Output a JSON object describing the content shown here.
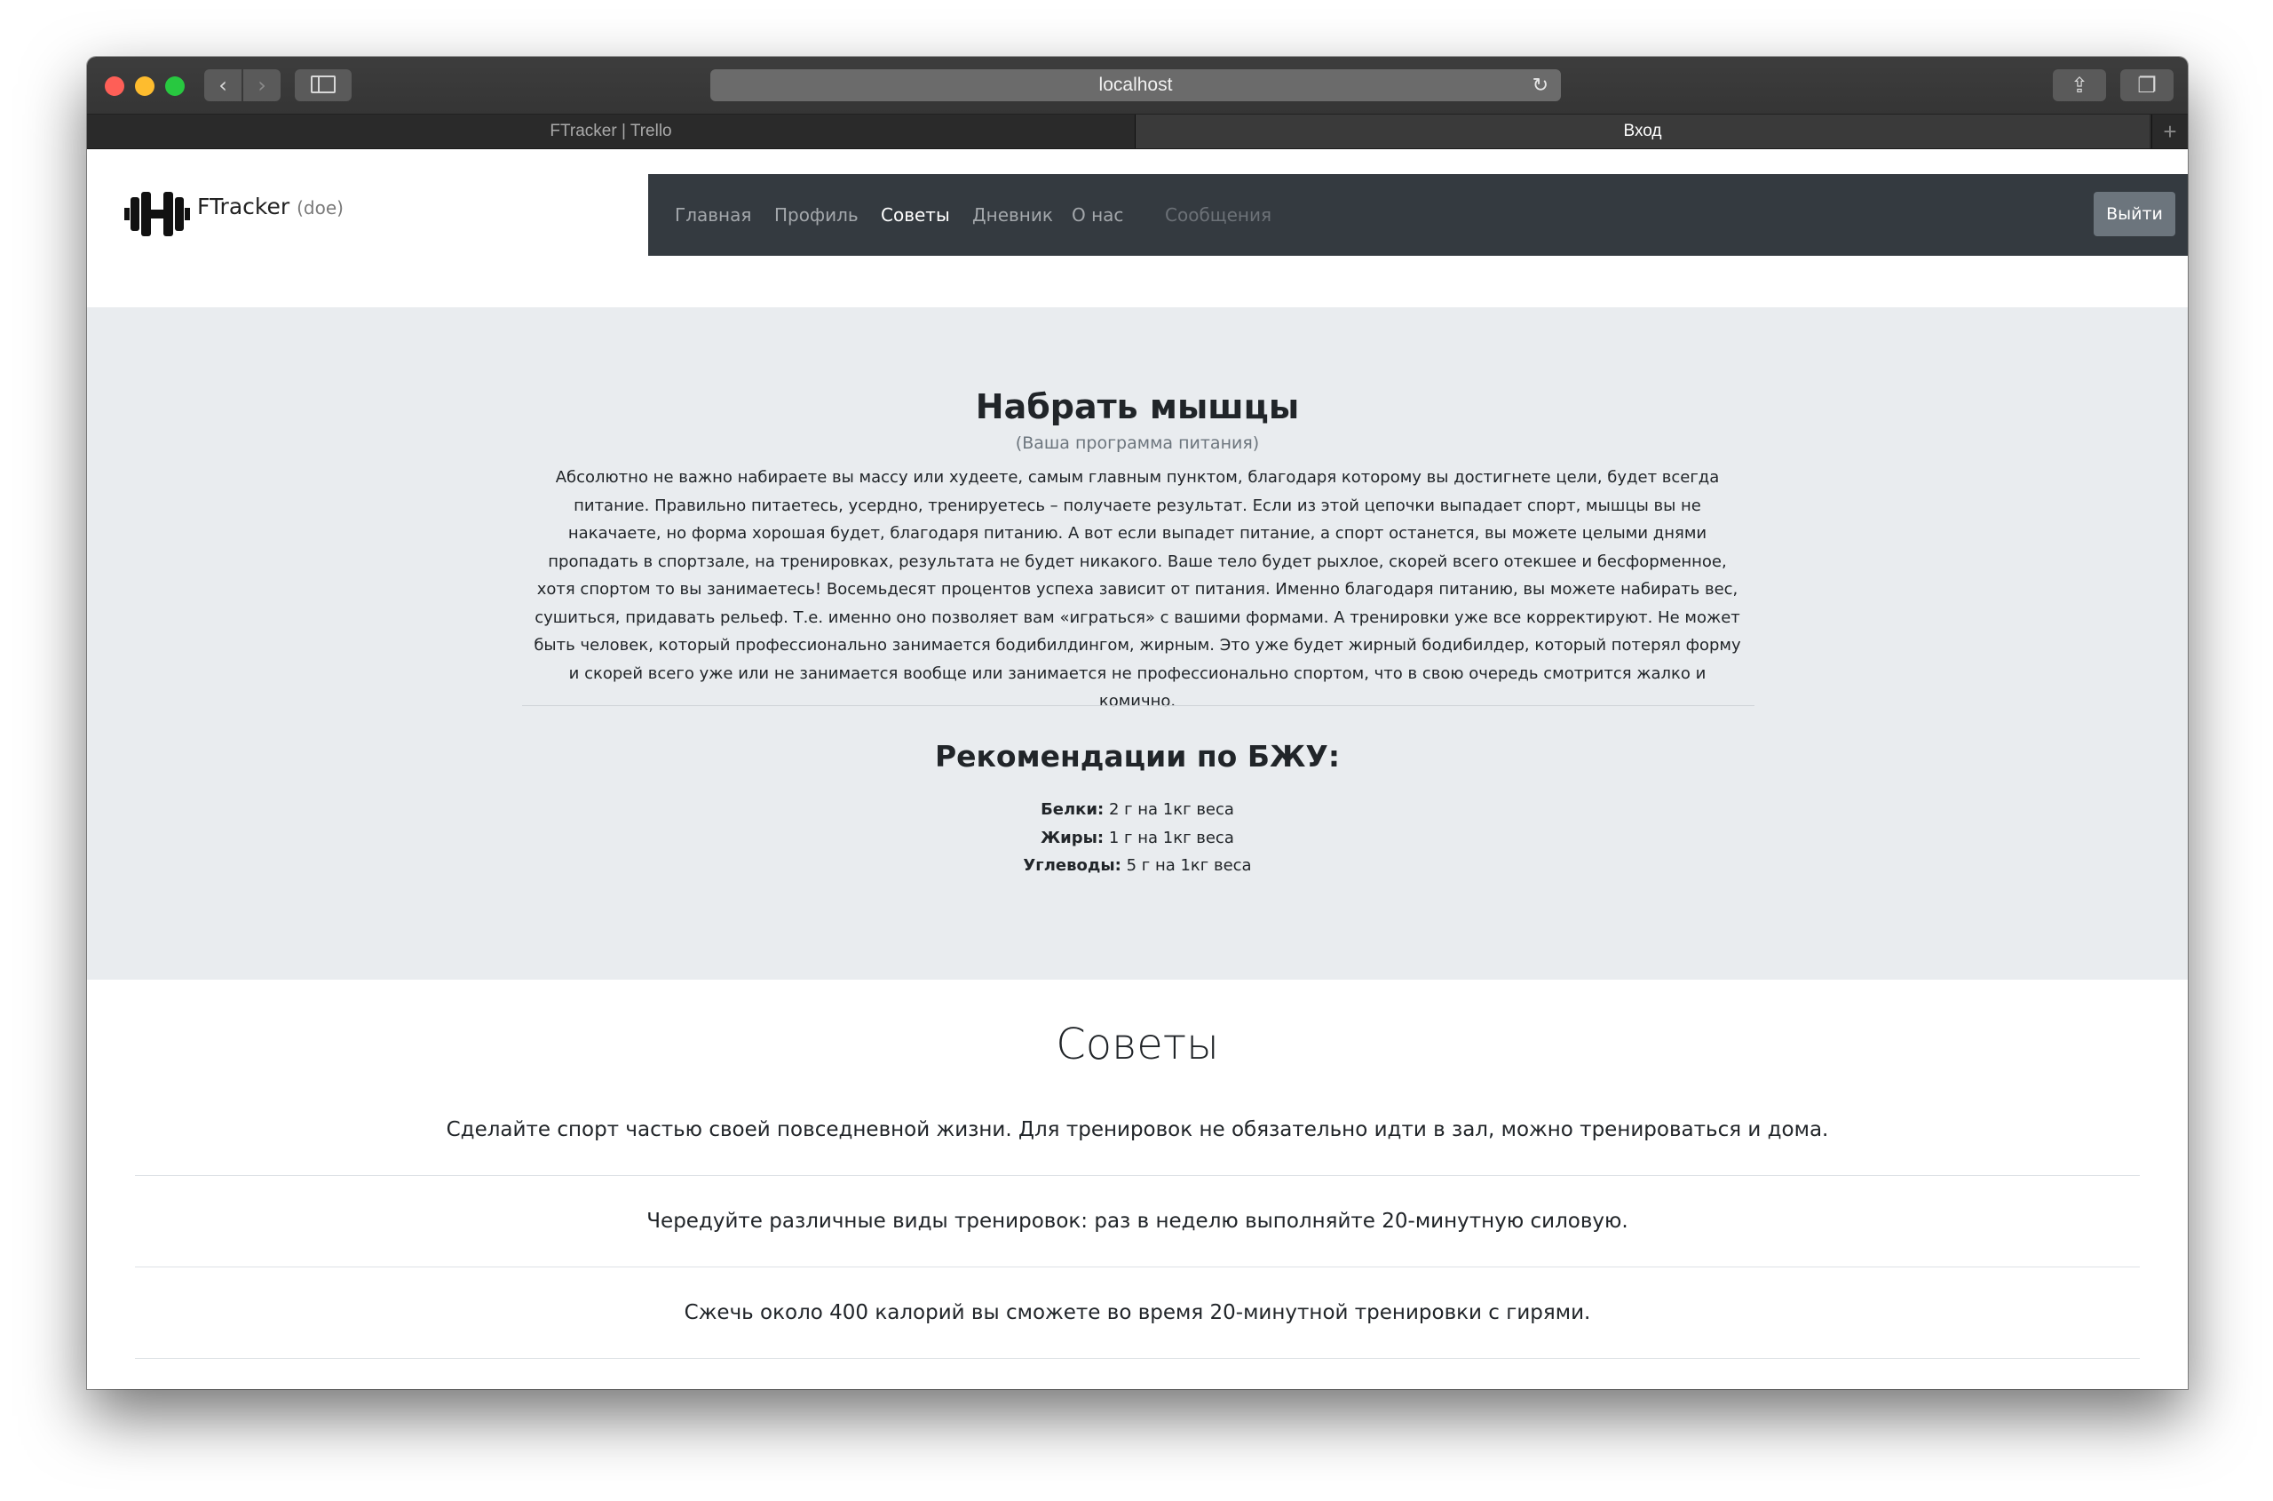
{
  "browser": {
    "url": "localhost",
    "tabs": [
      {
        "label": "FTracker | Trello"
      },
      {
        "label": "Вход"
      }
    ],
    "new_tab": "+"
  },
  "site": {
    "brand": "FTracker",
    "user": "(doe)",
    "nav": [
      {
        "label": "Главная",
        "state": "normal"
      },
      {
        "label": "Профиль",
        "state": "normal"
      },
      {
        "label": "Советы",
        "state": "active"
      },
      {
        "label": "Дневник",
        "state": "normal"
      },
      {
        "label": "О нас",
        "state": "normal"
      },
      {
        "label": "Сообщения",
        "state": "disabled"
      }
    ],
    "logout": "Выйти"
  },
  "jumbotron": {
    "title": "Набрать мышцы",
    "subtitle": "(Ваша программа питания)",
    "text": "Абсолютно не важно набираете вы массу или худеете, самым главным пунктом, благодаря которому вы достигнете цели, будет всегда питание. Правильно питаетесь, усердно, тренируетесь – получаете результат. Если из этой цепочки выпадает спорт, мышцы вы не накачаете, но форма хорошая будет, благодаря питанию. А вот если выпадет питание, а спорт останется, вы можете целыми днями пропадать в спортзале, на тренировках, результата не будет никакого. Ваше тело будет рыхлое, скорей всего отекшее и бесформенное, хотя спортом то вы занимаетесь! Восемьдесят процентов успеха зависит от питания. Именно благодаря питанию, вы можете набирать вес, сушиться, придавать рельеф. Т.е. именно оно позволяет вам «играться» с вашими формами. А тренировки уже все корректируют. Не может быть человек, который профессионально занимается бодибилдингом, жирным. Это уже будет жирный бодибилдер, который потерял форму и скорей всего уже или не занимается вообще или занимается не профессионально спортом, что в свою очередь смотрится жалко и комично.",
    "recommendations_title": "Рекомендации по БЖУ:",
    "macros": [
      {
        "label": "Белки:",
        "value": "2 г на 1кг веса"
      },
      {
        "label": "Жиры:",
        "value": "1 г на 1кг веса"
      },
      {
        "label": "Углеводы:",
        "value": "5 г на 1кг веса"
      }
    ]
  },
  "tips": {
    "title": "Советы",
    "items": [
      "Сделайте спорт частью своей повседневной жизни. Для тренировок не обязательно идти в зал, можно тренироваться и дома.",
      "Чередуйте различные виды тренировок: раз в неделю выполняйте 20-минутную силовую.",
      "Сжечь около 400 калорий вы сможете во время 20-минутной тренировки с гирями."
    ]
  }
}
